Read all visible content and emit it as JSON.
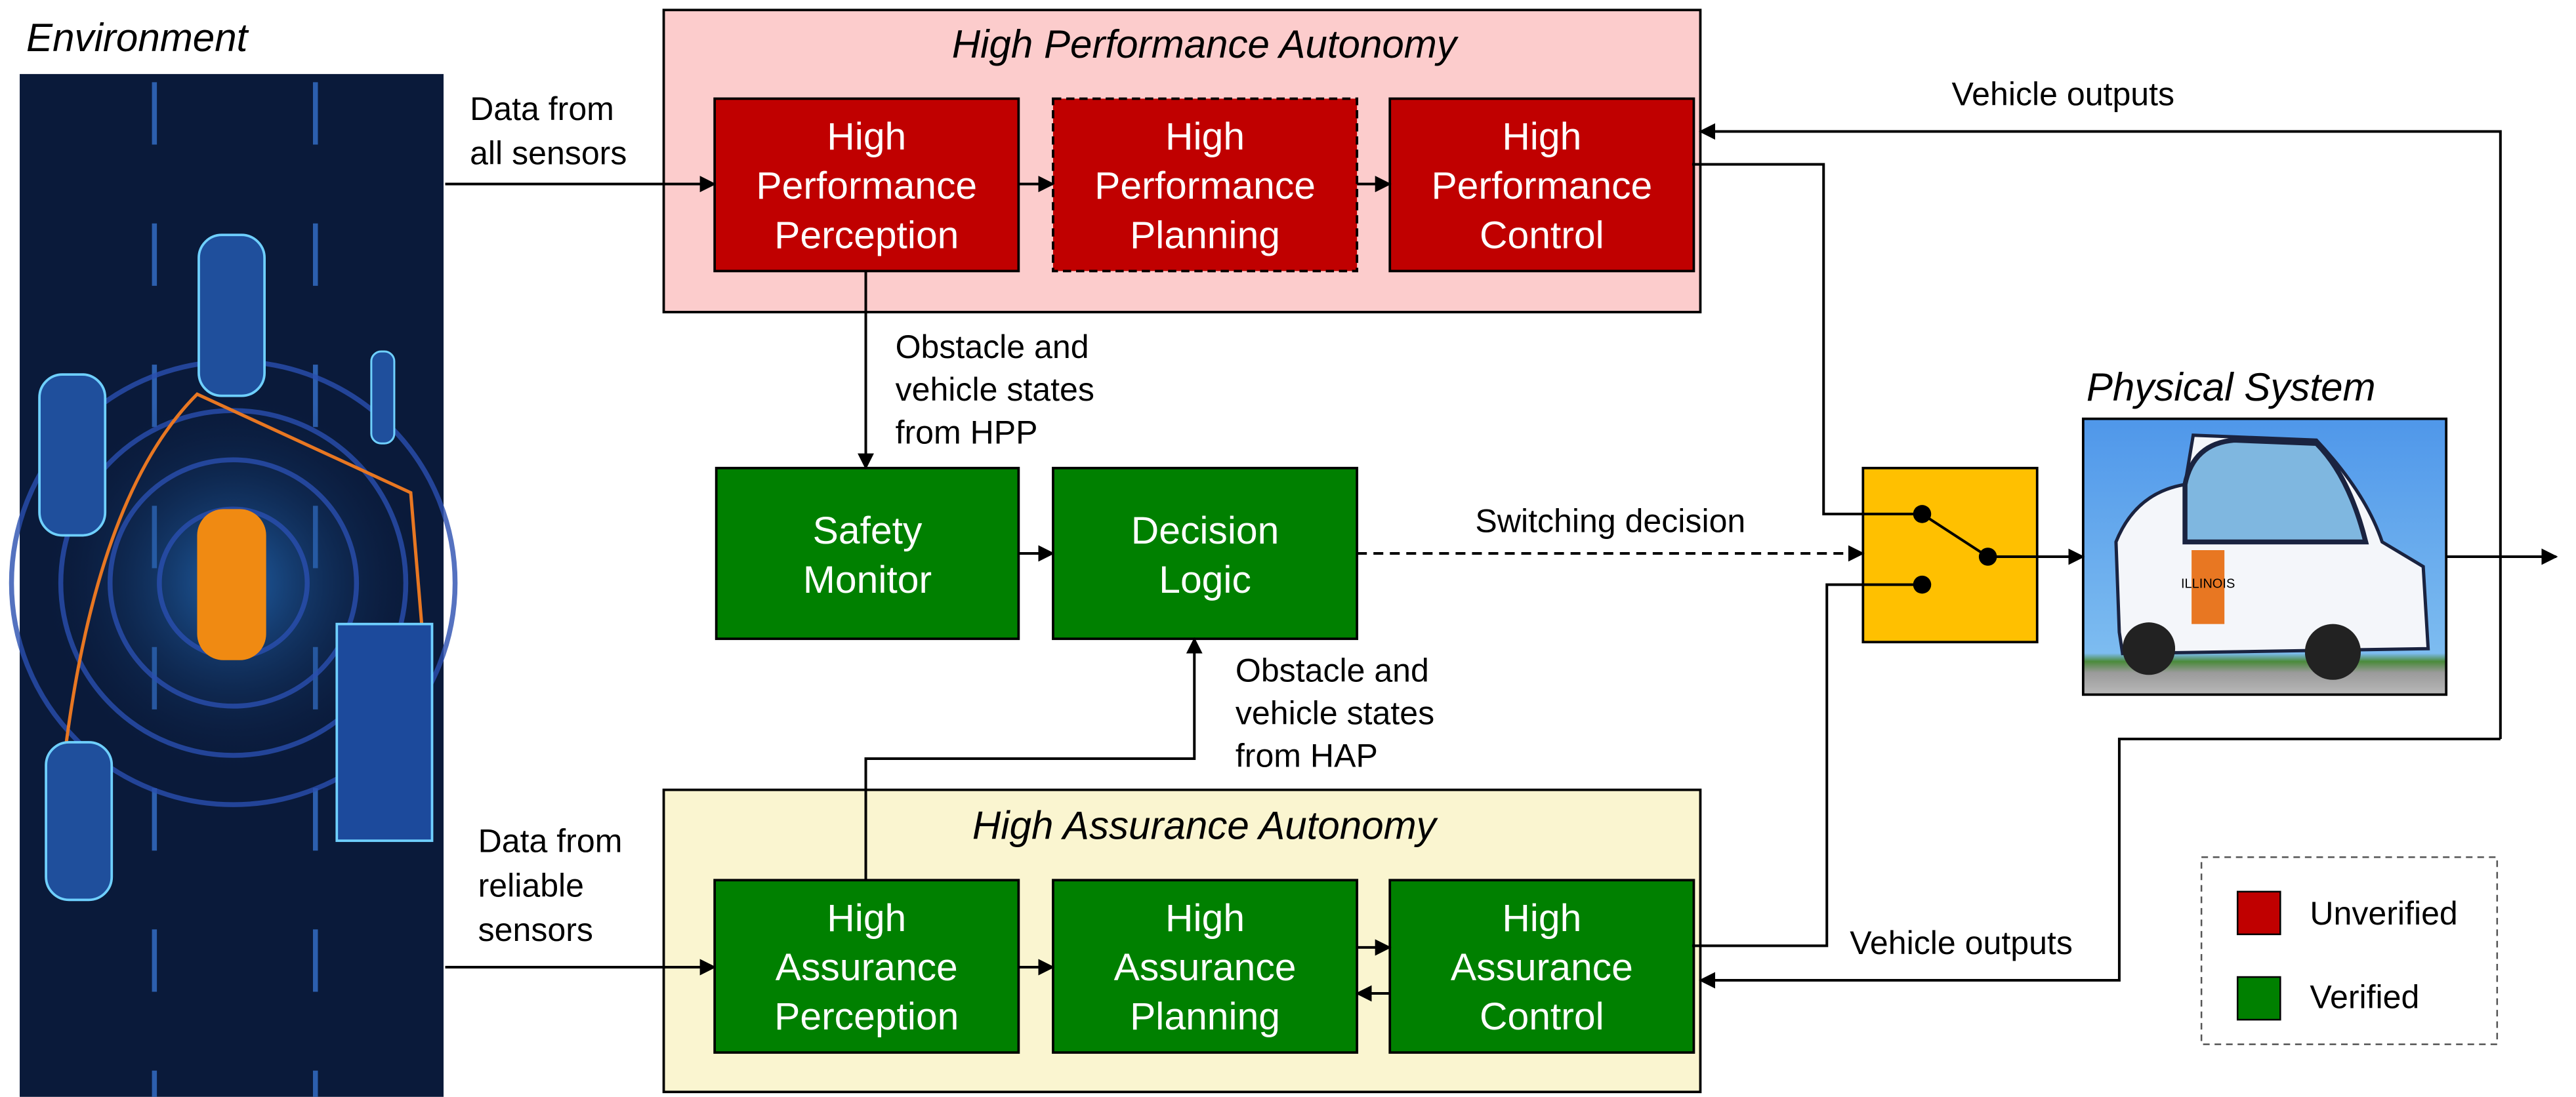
{
  "environment": {
    "title": "Environment"
  },
  "colors": {
    "unverified": "#c00000",
    "verified": "#008000",
    "hpa_background": "#fccccc",
    "haa_background": "#faf5d0",
    "switch": "#ffc000"
  },
  "high_performance": {
    "title": "High Performance Autonomy",
    "perception": [
      "High",
      "Performance",
      "Perception"
    ],
    "planning": [
      "High",
      "Performance",
      "Planning"
    ],
    "control": [
      "High",
      "Performance",
      "Control"
    ]
  },
  "high_assurance": {
    "title": "High Assurance Autonomy",
    "perception": [
      "High",
      "Assurance",
      "Perception"
    ],
    "planning": [
      "High",
      "Assurance",
      "Planning"
    ],
    "control": [
      "High",
      "Assurance",
      "Control"
    ]
  },
  "safety_monitor": [
    "Safety",
    "Monitor"
  ],
  "decision_logic": [
    "Decision",
    "Logic"
  ],
  "labels": {
    "data_all_sensors": [
      "Data from",
      "all sensors"
    ],
    "data_reliable_sensors": [
      "Data from",
      "reliable",
      "sensors"
    ],
    "states_from_hpp": [
      "Obstacle and",
      "vehicle states",
      "from HPP"
    ],
    "states_from_hap": [
      "Obstacle and",
      "vehicle states",
      "from HAP"
    ],
    "switching_decision": "Switching decision",
    "vehicle_outputs_top": "Vehicle outputs",
    "vehicle_outputs_bottom": "Vehicle outputs"
  },
  "physical_system": {
    "title": "Physical System",
    "logo_text": "ILLINOIS"
  },
  "legend": {
    "items": [
      {
        "label": "Unverified",
        "color": "#c00000"
      },
      {
        "label": "Verified",
        "color": "#008000"
      }
    ]
  }
}
